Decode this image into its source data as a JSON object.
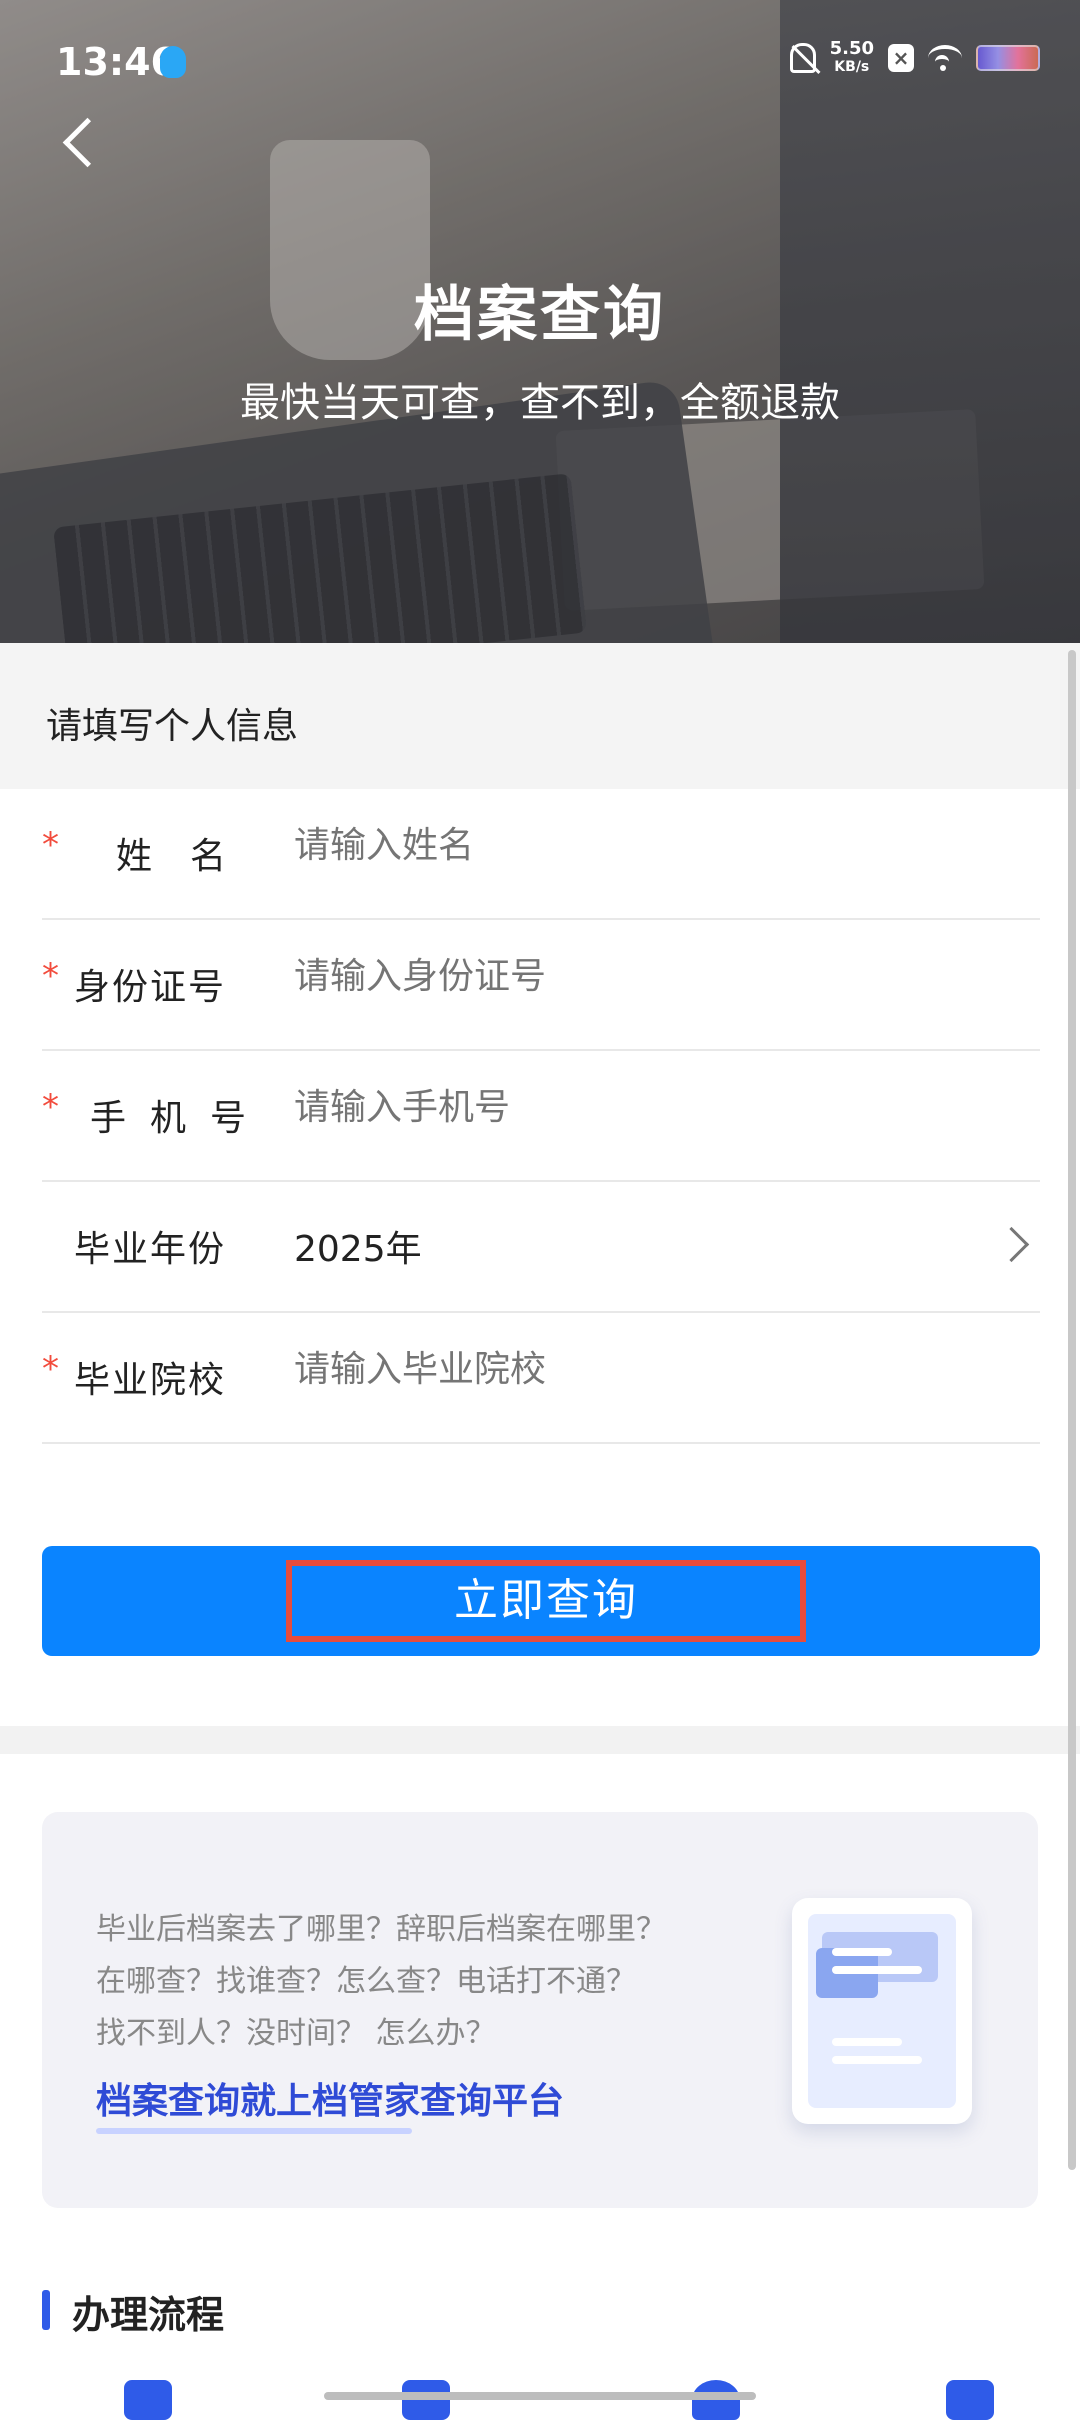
{
  "status_bar": {
    "time": "13:46",
    "net_speed_value": "5.50",
    "net_speed_unit": "KB/s"
  },
  "hero": {
    "title": "档案查询",
    "subtitle": "最快当天可查，查不到，全额退款"
  },
  "form": {
    "section_title": "请填写个人信息",
    "required_mark": "*",
    "fields": [
      {
        "label": "姓名",
        "placeholder": "请输入姓名",
        "required": true
      },
      {
        "label": "身份证号",
        "placeholder": "请输入身份证号",
        "required": true
      },
      {
        "label": "手机号",
        "placeholder": "请输入手机号",
        "required": true
      },
      {
        "label": "毕业年份",
        "value": "2025年",
        "required": false
      },
      {
        "label": "毕业院校",
        "placeholder": "请输入毕业院校",
        "required": true
      }
    ],
    "submit_label": "立即查询"
  },
  "info_card": {
    "lines": [
      "毕业后档案去了哪里？辞职后档案在哪里？",
      "在哪查？找谁查？怎么查？电话打不通？",
      "找不到人？没时间？ 怎么办？"
    ],
    "link_text": "档案查询就上档管家查询平台"
  },
  "process": {
    "title": "办理流程"
  },
  "colors": {
    "primary": "#0a84ff",
    "required": "#f24b3c",
    "highlight_border": "#e74c3c",
    "link": "#2f4bd6"
  }
}
